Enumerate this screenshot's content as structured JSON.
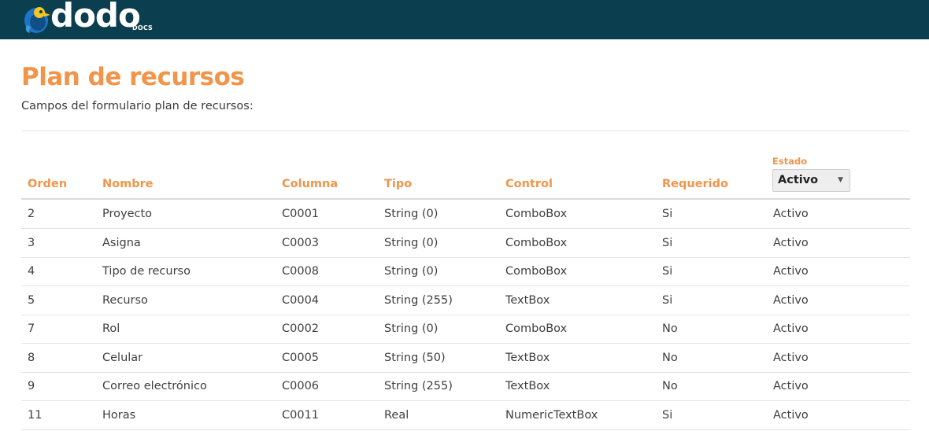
{
  "header": {
    "logo_text": "dodo",
    "logo_registered": "®",
    "logo_sub": "DOCS"
  },
  "page": {
    "title": "Plan de recursos",
    "subtitle": "Campos del formulario plan de recursos:"
  },
  "filter": {
    "label": "Estado",
    "selected": "Activo"
  },
  "table": {
    "columns": [
      "Orden",
      "Nombre",
      "Columna",
      "Tipo",
      "Control",
      "Requerido"
    ],
    "rows": [
      [
        "2",
        "Proyecto",
        "C0001",
        "String (0)",
        "ComboBox",
        "Si",
        "Activo"
      ],
      [
        "3",
        "Asigna",
        "C0003",
        "String (0)",
        "ComboBox",
        "Si",
        "Activo"
      ],
      [
        "4",
        "Tipo de recurso",
        "C0008",
        "String (0)",
        "ComboBox",
        "Si",
        "Activo"
      ],
      [
        "5",
        "Recurso",
        "C0004",
        "String (255)",
        "TextBox",
        "Si",
        "Activo"
      ],
      [
        "7",
        "Rol",
        "C0002",
        "String (0)",
        "ComboBox",
        "No",
        "Activo"
      ],
      [
        "8",
        "Celular",
        "C0005",
        "String (50)",
        "TextBox",
        "No",
        "Activo"
      ],
      [
        "9",
        "Correo electrónico",
        "C0006",
        "String (255)",
        "TextBox",
        "No",
        "Activo"
      ],
      [
        "11",
        "Horas",
        "C0011",
        "Real",
        "NumericTextBox",
        "Si",
        "Activo"
      ]
    ]
  },
  "colors": {
    "topbar": "#0b3e4e",
    "accent": "#f0954a",
    "logo_bird_blue": "#1e74c6",
    "logo_bird_yellow": "#f3c623"
  }
}
